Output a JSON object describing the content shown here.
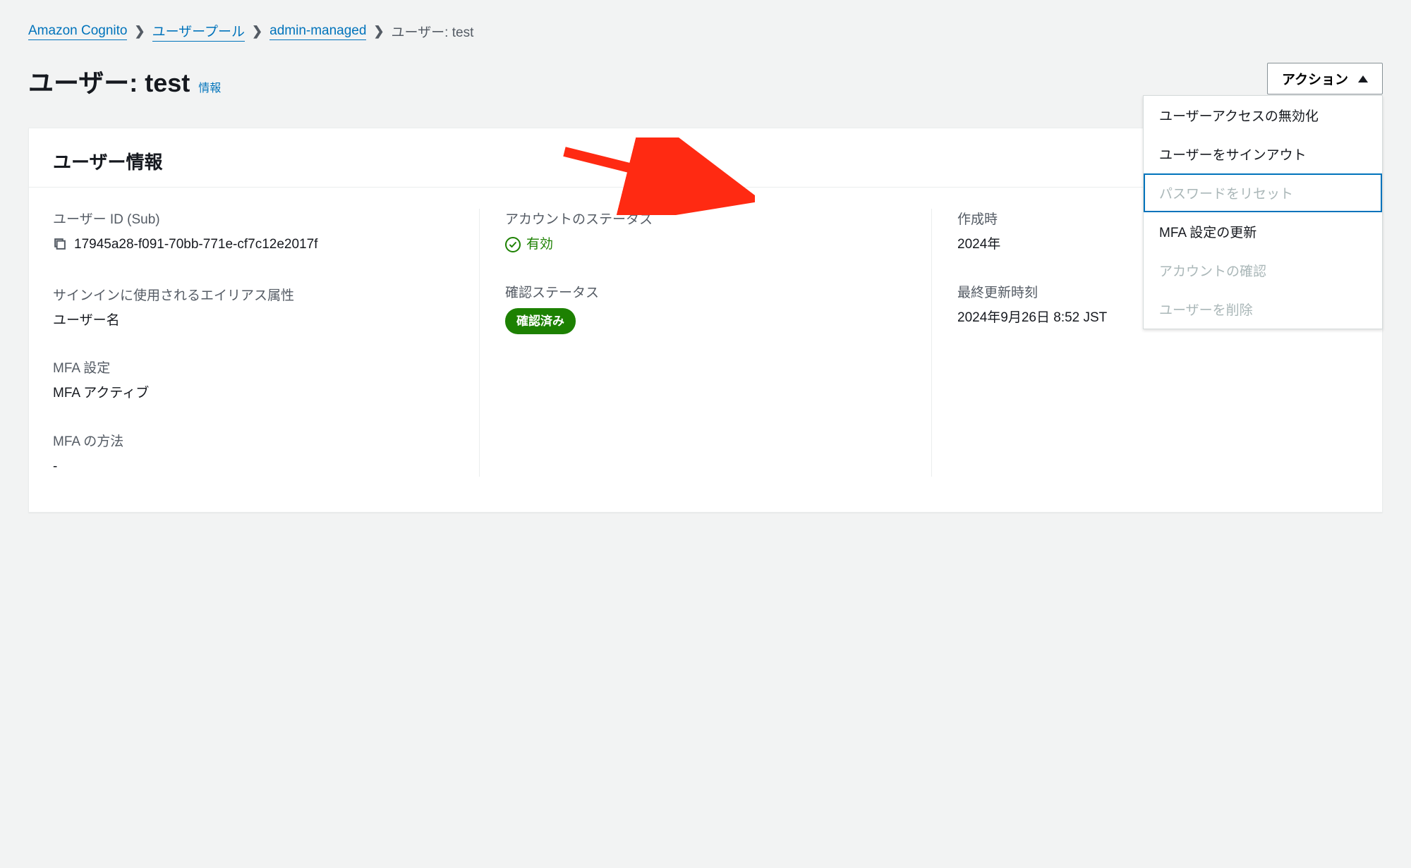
{
  "breadcrumb": {
    "items": [
      "Amazon Cognito",
      "ユーザープール",
      "admin-managed",
      "ユーザー: test"
    ]
  },
  "header": {
    "title": "ユーザー: test",
    "info_label": "情報"
  },
  "actions": {
    "button_label": "アクション",
    "menu": [
      {
        "label": "ユーザーアクセスの無効化",
        "enabled": true
      },
      {
        "label": "ユーザーをサインアウト",
        "enabled": true
      },
      {
        "label": "パスワードをリセット",
        "enabled": false,
        "highlighted": true
      },
      {
        "label": "MFA 設定の更新",
        "enabled": true
      },
      {
        "label": "アカウントの確認",
        "enabled": false
      },
      {
        "label": "ユーザーを削除",
        "enabled": false
      }
    ]
  },
  "panel": {
    "heading": "ユーザー情報",
    "col1": {
      "user_id_label": "ユーザー ID (Sub)",
      "user_id_value": "17945a28-f091-70bb-771e-cf7c12e2017f",
      "alias_label": "サインインに使用されるエイリアス属性",
      "alias_value": "ユーザー名",
      "mfa_setting_label": "MFA 設定",
      "mfa_setting_value": "MFA アクティブ",
      "mfa_method_label": "MFA の方法",
      "mfa_method_value": "-"
    },
    "col2": {
      "account_status_label": "アカウントのステータス",
      "account_status_value": "有効",
      "confirm_status_label": "確認ステータス",
      "confirm_status_value": "確認済み"
    },
    "col3": {
      "created_label": "作成時",
      "created_value": "2024年",
      "updated_label": "最終更新時刻",
      "updated_value": "2024年9月26日 8:52 JST"
    }
  }
}
